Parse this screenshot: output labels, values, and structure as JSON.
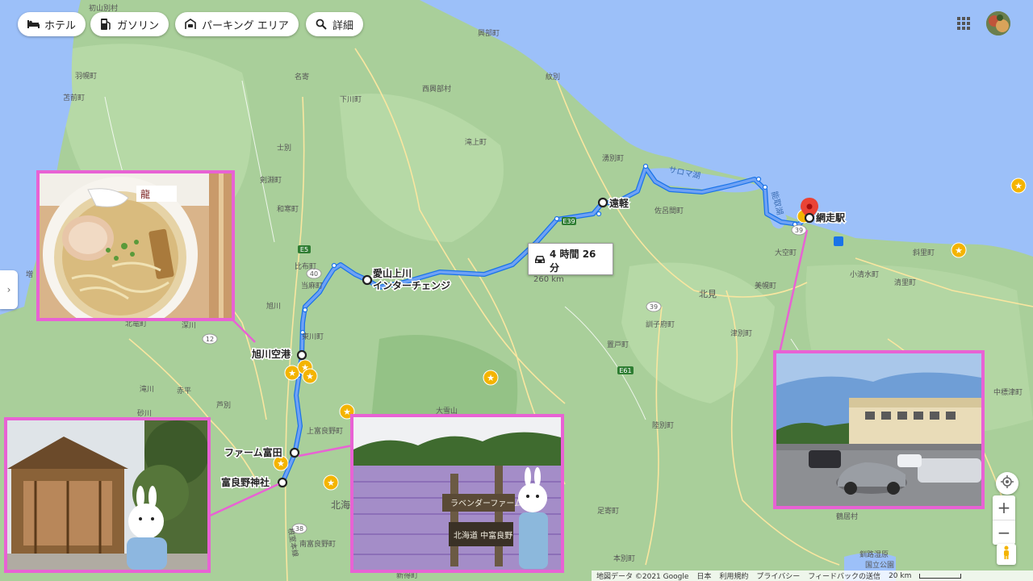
{
  "filters": [
    {
      "label": "ホテル",
      "icon": "bed-icon"
    },
    {
      "label": "ガソリン",
      "icon": "gas-station-icon"
    },
    {
      "label": "パーキング エリア",
      "icon": "parking-area-icon"
    },
    {
      "label": "詳細",
      "icon": "search-icon"
    }
  ],
  "route": {
    "duration": "4 時間 26 分",
    "distance": "260 km",
    "color": "#4285f4"
  },
  "stops": [
    {
      "name": "網走駅"
    },
    {
      "name": "遠軽"
    },
    {
      "name": "愛山上川\nインターチェンジ"
    },
    {
      "name": "旭川空港"
    },
    {
      "name": "ファーム富田"
    },
    {
      "name": "富良野神社"
    }
  ],
  "map_labels": {
    "towns": [
      "初山別村",
      "羽幌町",
      "苫前町",
      "名寄",
      "下川町",
      "西興部村",
      "興部町",
      "紋別",
      "滝上町",
      "湧別町",
      "士別",
      "剣淵町",
      "和寒町",
      "佐呂間町",
      "比布町",
      "当麻町",
      "旭川",
      "東川町",
      "北竜町",
      "深川",
      "滝川",
      "赤平",
      "芦別",
      "砂川",
      "上富良野町",
      "北海",
      "南富良野町",
      "新得町",
      "大雪山",
      "北見",
      "訓子府町",
      "置戸町",
      "美幌町",
      "津別町",
      "陸別町",
      "足寄町",
      "本別町",
      "鶴居村",
      "大空町",
      "小清水町",
      "斜里町",
      "清里町",
      "中標津町",
      "釧路湿原\n国立公園",
      "増"
    ],
    "water": [
      "サロマ湖",
      "能取湖"
    ],
    "roads": [
      "E5",
      "E39",
      "39",
      "40",
      "12",
      "38",
      "E61",
      "39"
    ]
  },
  "footer": {
    "map_data": "地図データ ©2021 Google",
    "country": "日本",
    "terms": "利用規約",
    "privacy": "プライバシー",
    "feedback": "フィードバックの送信",
    "scale": "20 km"
  },
  "colors": {
    "land": "#a9cf9a",
    "water": "#9cc0f9",
    "highlight_frame": "#e862d4",
    "pin": "#ea4335",
    "star": "#f4b400"
  }
}
